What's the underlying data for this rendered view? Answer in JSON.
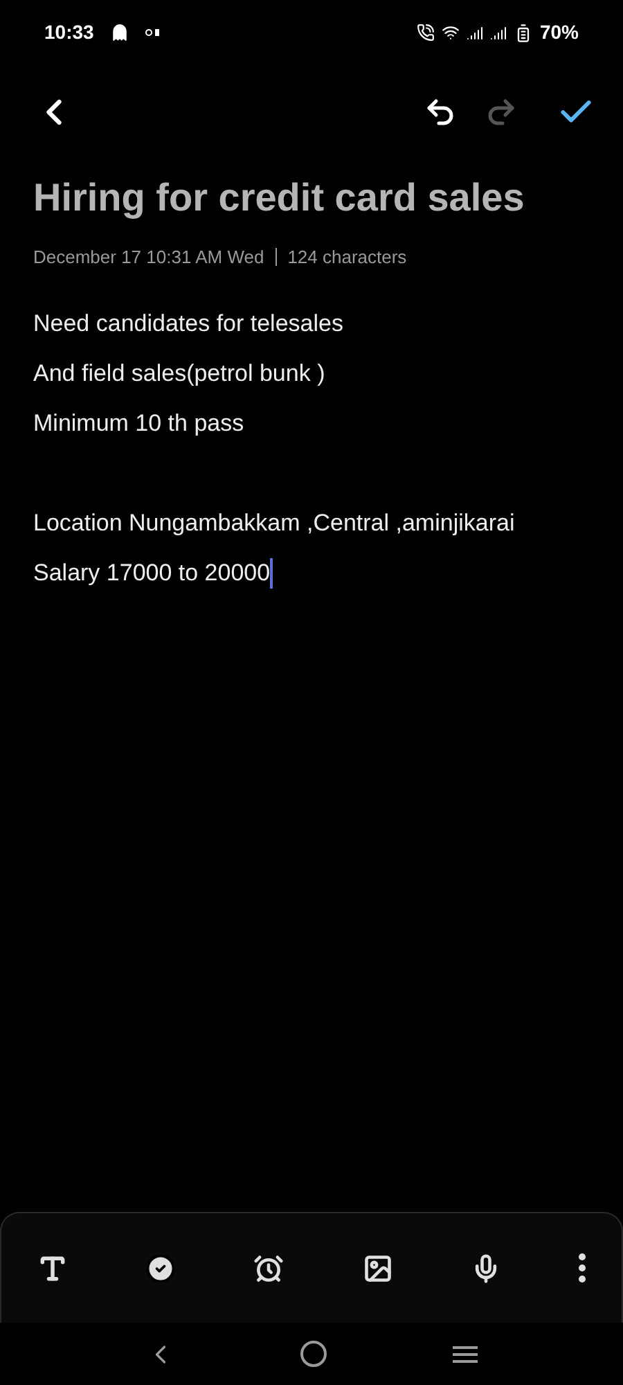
{
  "status_bar": {
    "time": "10:33",
    "battery": "70%"
  },
  "header": {
    "undo": {
      "disabled": false
    },
    "redo": {
      "disabled": true
    }
  },
  "note": {
    "title": "Hiring for credit card sales",
    "date": "December 17 10:31 AM Wed",
    "count": "124 characters",
    "paragraphs": [
      [
        {
          "text": "Need candidates for telesales",
          "cursor": false
        },
        {
          "text": "And field sales(petrol bunk )",
          "cursor": false
        },
        {
          "text": "Minimum 10 th pass",
          "cursor": false
        }
      ],
      [
        {
          "text": "Location Nungambakkam ,Central ,aminjikarai",
          "cursor": false
        },
        {
          "text": "Salary 17000 to 20000",
          "cursor": true
        }
      ]
    ]
  }
}
